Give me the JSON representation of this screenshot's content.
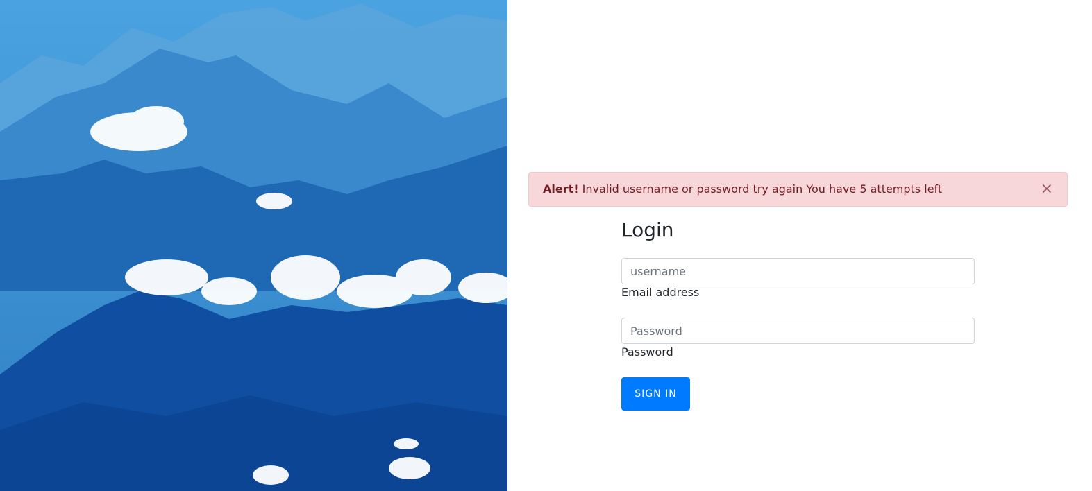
{
  "hero": {
    "image_icon": "mountain-landscape"
  },
  "alert": {
    "strong": "Alert!",
    "message": " Invalid username or password try again You have 5 attempts left",
    "close_label": "×"
  },
  "login": {
    "title": "Login",
    "username": {
      "placeholder": "username",
      "value": "",
      "label": "Email address"
    },
    "password": {
      "placeholder": "Password",
      "value": "",
      "label": "Password"
    },
    "submit_label": "SIGN IN"
  },
  "colors": {
    "primary": "#007bff",
    "alert_bg": "#f8d7da",
    "alert_text": "#721c24",
    "alert_border": "#f5c6cb"
  }
}
